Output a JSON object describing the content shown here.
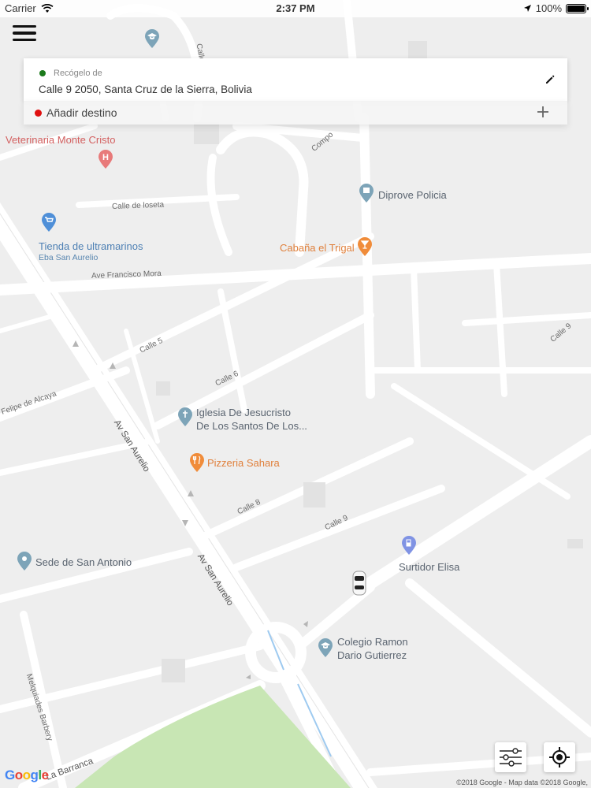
{
  "status_bar": {
    "carrier": "Carrier",
    "time": "2:37 PM",
    "battery": "100%"
  },
  "address_card": {
    "pickup_label": "Recógelo de",
    "pickup_address": "Calle 9 2050, Santa Cruz de la Sierra, Bolivia",
    "destination_label": "Añadir destino",
    "pickup_dot_color": "#1b7a1b",
    "destination_dot_color": "#e01010"
  },
  "map": {
    "pois": [
      {
        "name": "Veterinaria Monte Cristo",
        "icon": "hospital-pin-icon",
        "color": "#e26b6b"
      },
      {
        "name": "Diprove Policia",
        "icon": "government-pin-icon",
        "color": "#7a9cb0"
      },
      {
        "name": "Tienda de ultramarinos",
        "sub": "Eba San Aurelio",
        "icon": "shopping-cart-pin-icon",
        "color": "#4e8fd6"
      },
      {
        "name": "Cabaña el Trigal",
        "icon": "cocktail-pin-icon",
        "color": "#f08c3a"
      },
      {
        "name": "Iglesia De Jesucristo",
        "line2": "De Los Santos De Los...",
        "icon": "church-pin-icon",
        "color": "#7a9cb0"
      },
      {
        "name": "Pizzeria Sahara",
        "icon": "restaurant-pin-icon",
        "color": "#f08c3a"
      },
      {
        "name": "Surtidor Elisa",
        "icon": "gas-station-pin-icon",
        "color": "#7b8fe0"
      },
      {
        "name": "Sede de San Antonio",
        "icon": "place-pin-icon",
        "color": "#7a9cb0"
      },
      {
        "name": "Colegio Ramon",
        "line2": "Dario Gutierrez",
        "icon": "school-pin-icon",
        "color": "#7a9cb0"
      }
    ],
    "streets": {
      "calle_de_loseta": "Calle de loseta",
      "ave_francisco_mora": "Ave Francisco Mora",
      "calle_5": "Calle 5",
      "calle_6": "Calle 6",
      "calle_8": "Calle 8",
      "calle_9_a": "Calle 9",
      "calle_9_b": "Calle 9",
      "felipe_de_alcaya": "Felipe de Alcaya",
      "av_san_aurelio_a": "Av San Aurelio",
      "av_san_aurelio_b": "Av San Aurelio",
      "melquiades_barbery": "Melquiades Barbery",
      "la_barranca": "La Barranca",
      "compo": "Compo",
      "calle_top": "Calle"
    },
    "park_color": "#c8e6b4",
    "road_color": "#ffffff",
    "block_color": "#eeeeee"
  },
  "controls": {
    "filter_icon": "sliders-icon",
    "locate_icon": "my-location-icon"
  },
  "attribution": {
    "logo": "Google",
    "copyright": "©2018 Google - Map data ©2018 Google,"
  }
}
